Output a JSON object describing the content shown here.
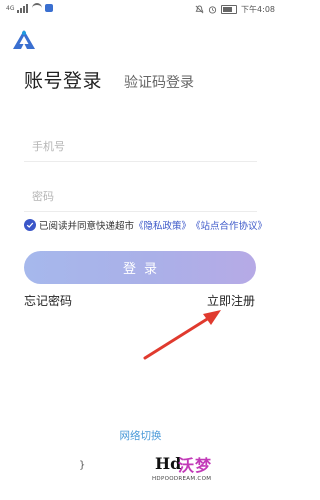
{
  "status_bar": {
    "signal": "4G",
    "time": "下午4:08",
    "icons": [
      "signal-icon",
      "wifi-icon",
      "app-notification-icon",
      "mute-icon",
      "alarm-icon",
      "battery-icon"
    ]
  },
  "app": {
    "logo_icon": "app-logo-icon",
    "brand_color": "#3a6fd0"
  },
  "tabs": {
    "account_login": "账号登录",
    "code_login": "验证码登录"
  },
  "form": {
    "phone_placeholder": "手机号",
    "phone_value": "",
    "password_placeholder": "密码",
    "password_value": ""
  },
  "agreement": {
    "checked": true,
    "prefix": "已阅读并同意快递超市",
    "privacy_link": "《隐私政策》",
    "site_link": "《站点合作协议》"
  },
  "login_button": "登录",
  "forgot_password": "忘记密码",
  "register": "立即注册",
  "network_switch": "网络切换",
  "cursor_mark": "}",
  "watermark": {
    "hd": "Hd",
    "cn": "沃梦",
    "url": "HDPOODREAM.COM"
  },
  "colors": {
    "link": "#3a56c8",
    "button_start": "#a6b8ec",
    "button_end": "#b6aae6",
    "network_link": "#4a9ad8",
    "arrow": "#e03a2e"
  }
}
